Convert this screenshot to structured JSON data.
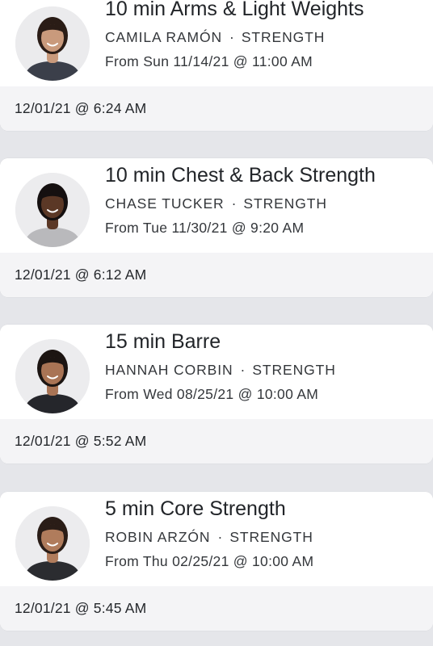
{
  "workouts": [
    {
      "title": "10 min Arms & Light Weights",
      "instructor": "CAMILA RAMÓN",
      "separator": "·",
      "category": "STRENGTH",
      "from": "From Sun 11/14/21 @ 11:00 AM",
      "taken_at": "12/01/21 @ 6:24 AM",
      "avatar": {
        "skin": "#c99a7c",
        "hair": "#2a1c16",
        "top": "#3b3f4a",
        "bg": "#ebebed"
      }
    },
    {
      "title": "10 min Chest & Back Strength",
      "instructor": "CHASE TUCKER",
      "separator": "·",
      "category": "STRENGTH",
      "from": "From Tue 11/30/21 @ 9:20 AM",
      "taken_at": "12/01/21 @ 6:12 AM",
      "avatar": {
        "skin": "#5b3826",
        "hair": "#151010",
        "top": "#b9b9bc",
        "bg": "#ececee"
      }
    },
    {
      "title": "15 min Barre",
      "instructor": "HANNAH CORBIN",
      "separator": "·",
      "category": "STRENGTH",
      "from": "From Wed 08/25/21 @ 10:00 AM",
      "taken_at": "12/01/21 @ 5:52 AM",
      "avatar": {
        "skin": "#a97455",
        "hair": "#1c1512",
        "top": "#25262b",
        "bg": "#ececee"
      }
    },
    {
      "title": "5 min Core Strength",
      "instructor": "ROBIN ARZÓN",
      "separator": "·",
      "category": "STRENGTH",
      "from": "From Thu 02/25/21 @ 10:00 AM",
      "taken_at": "12/01/21 @ 5:45 AM",
      "avatar": {
        "skin": "#b07c5c",
        "hair": "#2a1d17",
        "top": "#2b2c30",
        "bg": "#ececee"
      }
    }
  ]
}
